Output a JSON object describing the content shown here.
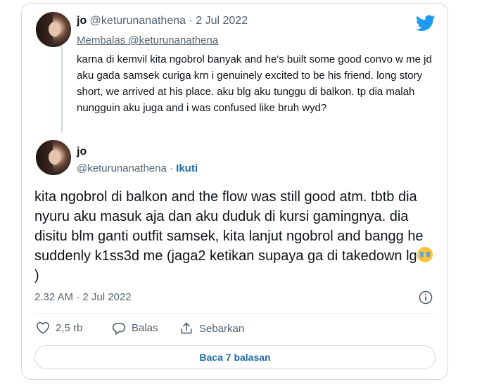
{
  "reply_tweet": {
    "name": "jo",
    "handle": "@keturunanathena",
    "dot": "·",
    "date": "2 Jul 2022",
    "replying_to": "Membalas @keturunanathena",
    "text": "karna di kemvil kita ngobrol banyak and he's built some good convo w me jd aku gada samsek curiga krn i genuinely excited to be his friend. long story short, we arrived at his place. aku blg aku tunggu di balkon. tp dia malah nungguin aku juga and i was confused like bruh wyd?"
  },
  "main_tweet": {
    "name": "jo",
    "handle": "@keturunanathena",
    "dot": "·",
    "follow_label": "Ikuti",
    "text": "kita ngobrol di balkon and the flow was still good atm. tbtb dia nyuru aku masuk aja dan aku duduk di kursi gamingnya. dia disitu blm ganti outfit samsek, kita lanjut ngobrol and bangg he suddenly k1ss3d me (jaga2 ketikan supaya ga di takedown lg",
    "text_end": ")",
    "emoji": "crying-face",
    "timestamp": "2.32 AM · 2 Jul 2022"
  },
  "actions": {
    "like_count": "2,5 rb",
    "reply_label": "Balas",
    "share_label": "Sebarkan"
  },
  "read_replies_label": "Baca 7 balasan",
  "colors": {
    "twitter_blue": "#1d9bf0",
    "link_blue": "#1d6fa5",
    "muted": "#536471",
    "border": "#cfd9de"
  }
}
